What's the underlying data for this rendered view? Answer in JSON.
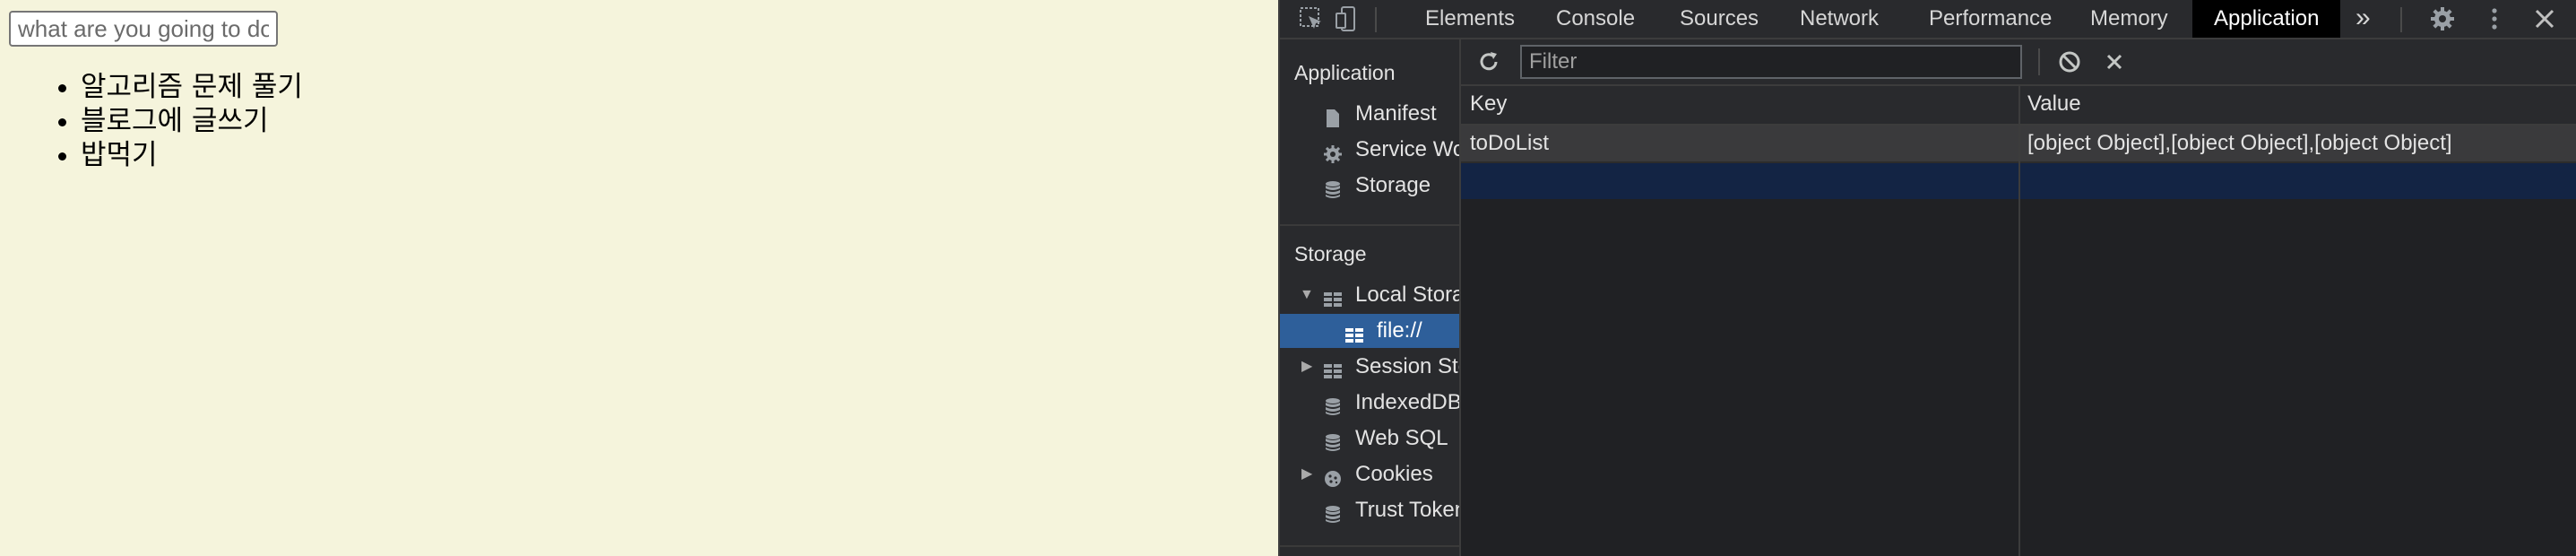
{
  "page": {
    "input_placeholder": "what are you going to do",
    "todos": [
      "알고리즘 문제 풀기",
      "블로그에 글쓰기",
      "밥먹기"
    ]
  },
  "devtools": {
    "tabs": [
      {
        "label": "Elements"
      },
      {
        "label": "Console"
      },
      {
        "label": "Sources"
      },
      {
        "label": "Network"
      },
      {
        "label": "Performance"
      },
      {
        "label": "Memory"
      },
      {
        "label": "Application",
        "active": true
      }
    ],
    "more_tabs_label": "»",
    "sidebar": {
      "application_title": "Application",
      "application_items": [
        {
          "label": "Manifest",
          "icon": "file-icon"
        },
        {
          "label": "Service Workers",
          "icon": "gear-icon"
        },
        {
          "label": "Storage",
          "icon": "database-icon"
        }
      ],
      "storage_title": "Storage",
      "storage_items": [
        {
          "label": "Local Storage",
          "icon": "table-icon",
          "expanded": true
        },
        {
          "label": "file://",
          "icon": "table-icon",
          "selected": true
        },
        {
          "label": "Session Storage",
          "icon": "table-icon",
          "expanded": false
        },
        {
          "label": "IndexedDB",
          "icon": "database-icon"
        },
        {
          "label": "Web SQL",
          "icon": "database-icon"
        },
        {
          "label": "Cookies",
          "icon": "cookie-icon",
          "expanded": false
        },
        {
          "label": "Trust Tokens",
          "icon": "database-icon"
        }
      ]
    },
    "toolbar": {
      "filter_placeholder": "Filter"
    },
    "table": {
      "columns": [
        "Key",
        "Value"
      ],
      "rows": [
        {
          "key": "toDoList",
          "value": "[object Object],[object Object],[object Object]"
        }
      ]
    },
    "colors": {
      "accent_selected": "#2e5f9a",
      "active_tab_bg": "#000000"
    }
  }
}
